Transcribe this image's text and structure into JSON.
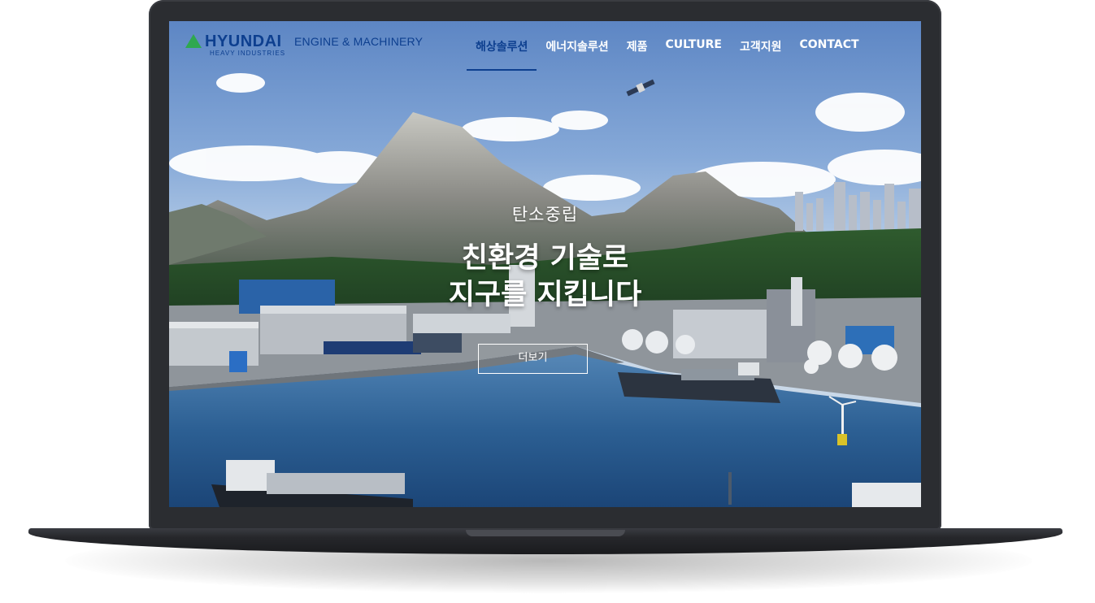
{
  "brand": {
    "logo_text": "HYUNDAI",
    "logo_subtext": "HEAVY INDUSTRIES",
    "division": "ENGINE & MACHINERY"
  },
  "nav": {
    "items": [
      {
        "label": "해상솔루션",
        "active": true
      },
      {
        "label": "에너지솔루션",
        "active": false
      },
      {
        "label": "제품",
        "active": false
      },
      {
        "label": "CULTURE",
        "active": false
      },
      {
        "label": "고객지원",
        "active": false
      },
      {
        "label": "CONTACT",
        "active": false
      }
    ]
  },
  "hero": {
    "eyebrow": "탄소중립",
    "headline_line1": "친환경 기술로",
    "headline_line2": "지구를 지킵니다",
    "button_label": "더보기"
  },
  "colors": {
    "brand_blue": "#0d3f8f",
    "logo_green": "#2fa84f",
    "laptop_body": "#2b2d31"
  }
}
